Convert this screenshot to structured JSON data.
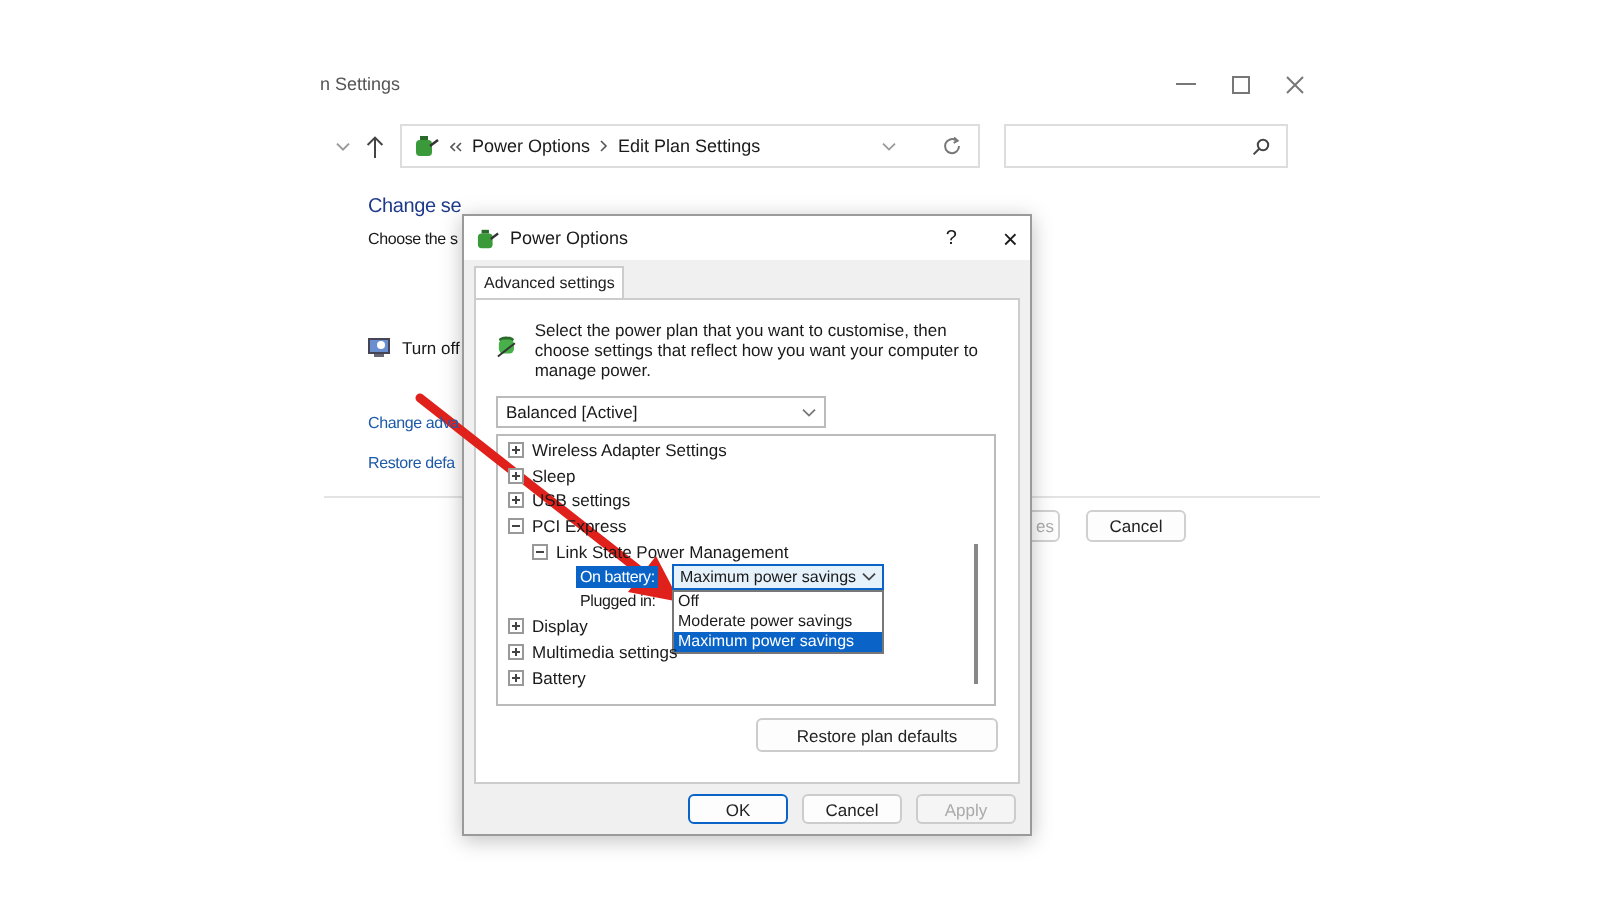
{
  "background_window": {
    "title": "n Settings",
    "breadcrumb": [
      "Power Options",
      "Edit Plan Settings"
    ],
    "heading": "Change se",
    "subtitle": "Choose the s",
    "display_setting": "Turn off",
    "links": [
      "Change adva",
      "Restore defa"
    ],
    "buttons": [
      {
        "label": "es"
      },
      {
        "label": "Cancel"
      }
    ]
  },
  "dialog": {
    "title": "Power Options",
    "help": "?",
    "close": "×",
    "tabs": [
      {
        "label": "Advanced settings",
        "selected": true
      }
    ],
    "intro": "Select the power plan that you want to customise, then choose settings that reflect how you want your computer to manage power.",
    "plan_select": {
      "value": "Balanced [Active]"
    },
    "tree": [
      {
        "kind": "group",
        "label": "Wireless Adapter Settings",
        "expanded": false
      },
      {
        "kind": "group",
        "label": "Sleep",
        "expanded": false
      },
      {
        "kind": "group",
        "label": "USB settings",
        "expanded": false
      },
      {
        "kind": "group",
        "label": "PCI Express",
        "expanded": true,
        "children": [
          {
            "kind": "group",
            "label": "Link State Power Management",
            "expanded": true,
            "children": [
              {
                "kind": "setting",
                "label": "On battery:",
                "selected": true,
                "value": "Maximum power savings",
                "options": [
                  {
                    "label": "Off",
                    "selected": false
                  },
                  {
                    "label": "Moderate power savings",
                    "selected": false
                  },
                  {
                    "label": "Maximum power savings",
                    "selected": true
                  }
                ]
              },
              {
                "kind": "setting",
                "label": "Plugged in:",
                "selected": false
              }
            ]
          }
        ]
      },
      {
        "kind": "group",
        "label": "Display",
        "expanded": false
      },
      {
        "kind": "group",
        "label": "Multimedia settings",
        "expanded": false
      },
      {
        "kind": "group",
        "label": "Battery",
        "expanded": false
      }
    ],
    "restore_button": "Restore plan defaults",
    "buttons": [
      {
        "label": "OK",
        "default": true,
        "disabled": false
      },
      {
        "label": "Cancel",
        "default": false,
        "disabled": false
      },
      {
        "label": "Apply",
        "default": false,
        "disabled": true
      }
    ]
  }
}
